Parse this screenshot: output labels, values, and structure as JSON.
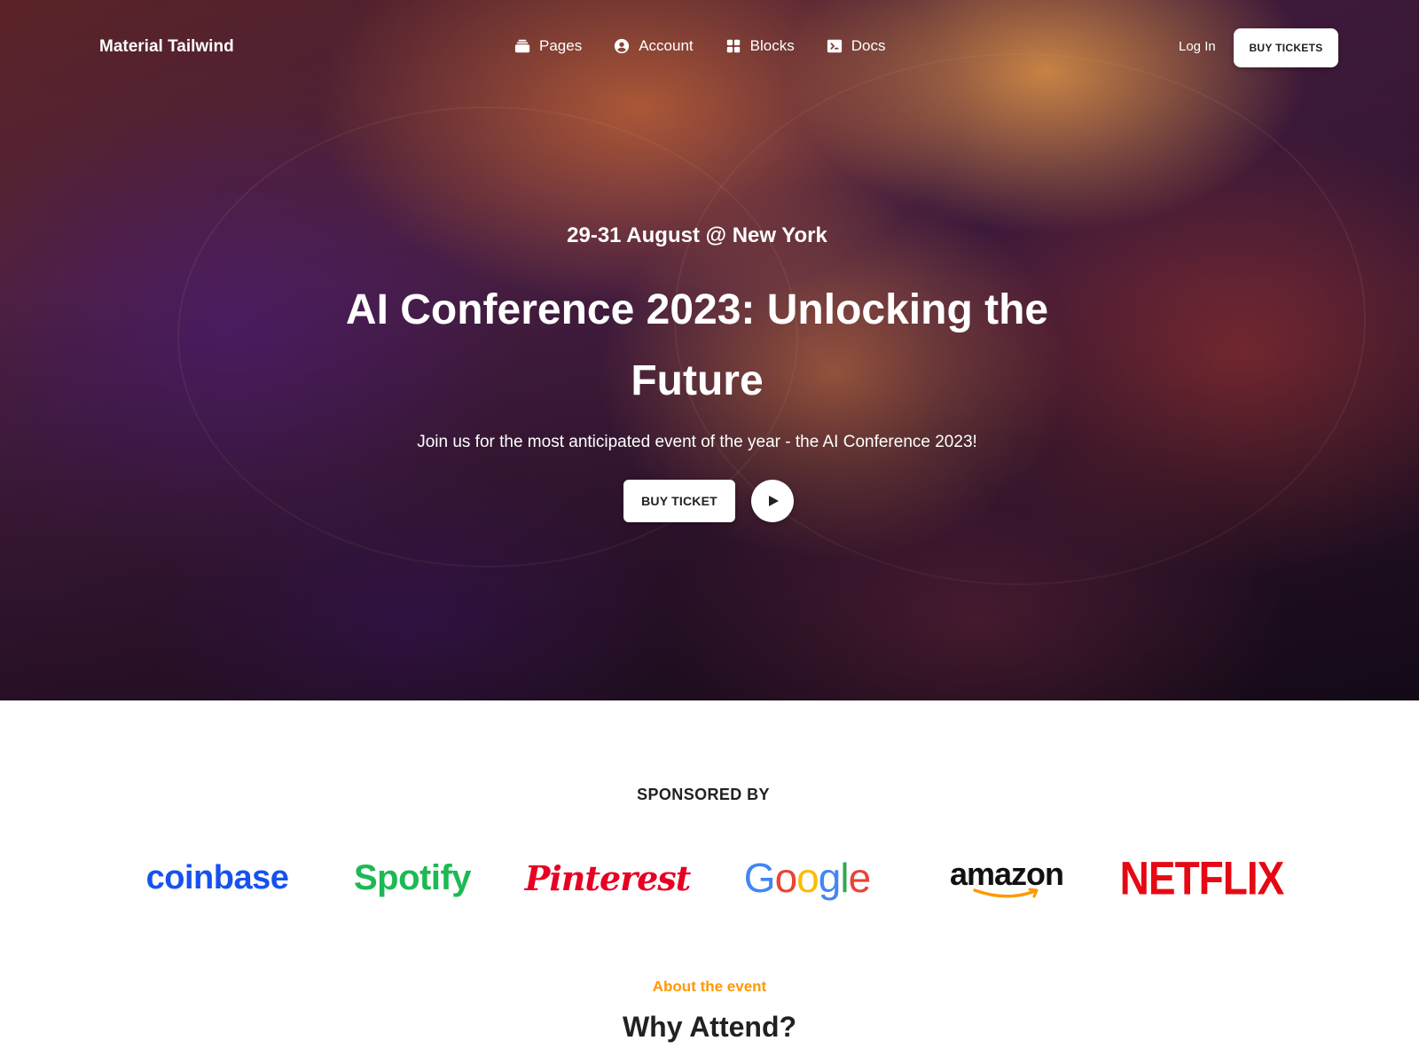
{
  "nav": {
    "brand": "Material Tailwind",
    "items": [
      {
        "label": "Pages",
        "icon": "rectangle-stack-icon"
      },
      {
        "label": "Account",
        "icon": "user-circle-icon"
      },
      {
        "label": "Blocks",
        "icon": "squares-icon"
      },
      {
        "label": "Docs",
        "icon": "command-line-icon"
      }
    ],
    "login": "Log In",
    "buy_tickets": "BUY TICKETS"
  },
  "hero": {
    "date": "29-31 August @ New York",
    "title": "AI Conference 2023: Unlocking the Future",
    "subtitle": "Join us for the most anticipated event of the year - the AI Conference 2023!",
    "buy_ticket": "BUY TICKET",
    "play_icon": "play-icon"
  },
  "sponsors": {
    "heading": "SPONSORED BY",
    "logos": [
      "coinbase",
      "Spotify",
      "Pinterest",
      "Google",
      "amazon",
      "NETFLIX"
    ]
  },
  "about": {
    "eyebrow": "About the event",
    "heading": "Why Attend?"
  },
  "colors": {
    "accent": "#ff9800",
    "coinbase": "#1652f0",
    "spotify": "#1db954",
    "pinterest": "#e60023",
    "netflix": "#e50914"
  }
}
